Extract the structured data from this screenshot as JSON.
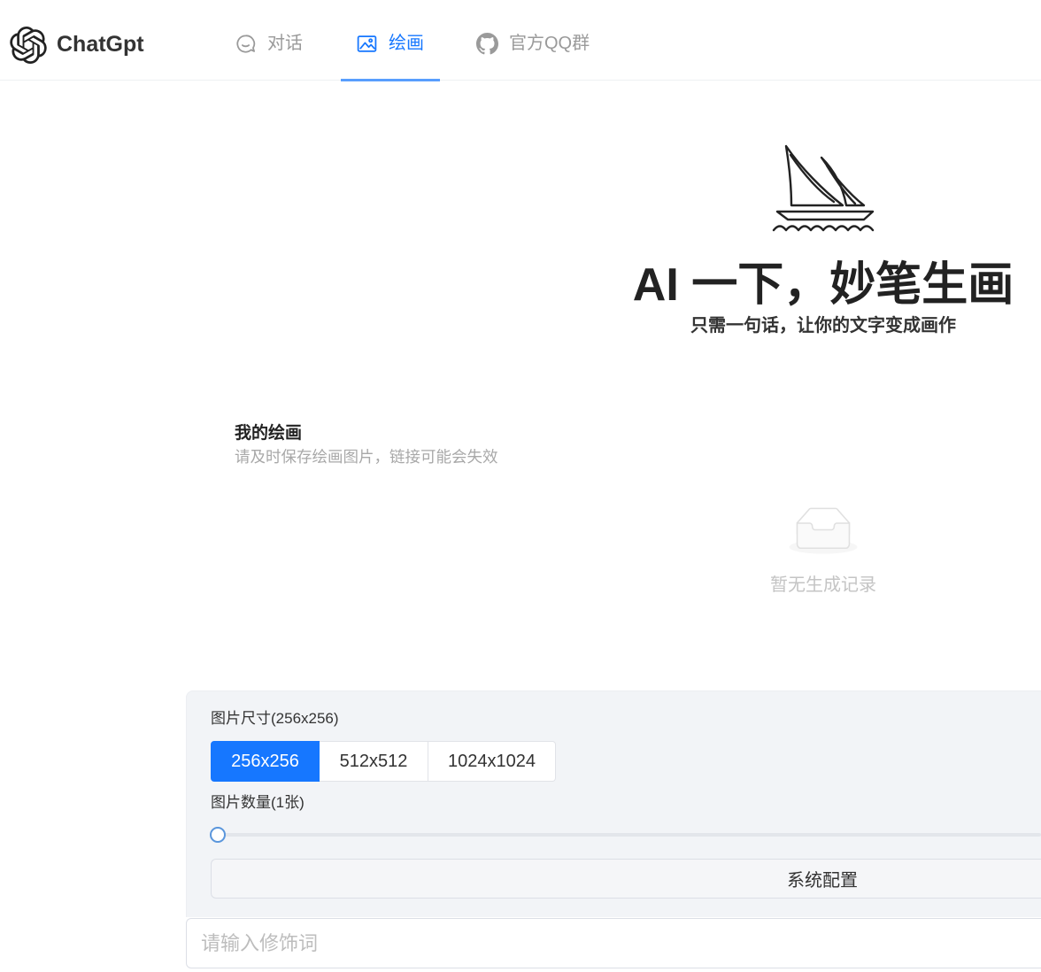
{
  "header": {
    "logo_icon": "openai-logo-icon",
    "app_name": "ChatGpt",
    "nav": [
      {
        "label": "对话",
        "icon": "chat-icon",
        "active": false
      },
      {
        "label": "绘画",
        "icon": "image-icon",
        "active": true
      },
      {
        "label": "官方QQ群",
        "icon": "github-icon",
        "active": false
      }
    ]
  },
  "hero": {
    "icon": "sailboat-icon",
    "title": "AI 一下，妙笔生画",
    "subtitle": "只需一句话，让你的文字变成画作"
  },
  "gallery": {
    "title": "我的绘画",
    "subtitle": "请及时保存绘画图片，链接可能会失效",
    "empty_icon": "inbox-icon",
    "empty_text": "暂无生成记录"
  },
  "settings": {
    "size_label": "图片尺寸(256x256)",
    "size_options": [
      {
        "label": "256x256",
        "selected": true
      },
      {
        "label": "512x512",
        "selected": false
      },
      {
        "label": "1024x1024",
        "selected": false
      }
    ],
    "count_label": "图片数量(1张)",
    "count_slider_level": 0,
    "config_button": "系统配置"
  },
  "prompt": {
    "placeholder": "请输入修饰词"
  },
  "colors": {
    "accent": "#1677ff"
  }
}
